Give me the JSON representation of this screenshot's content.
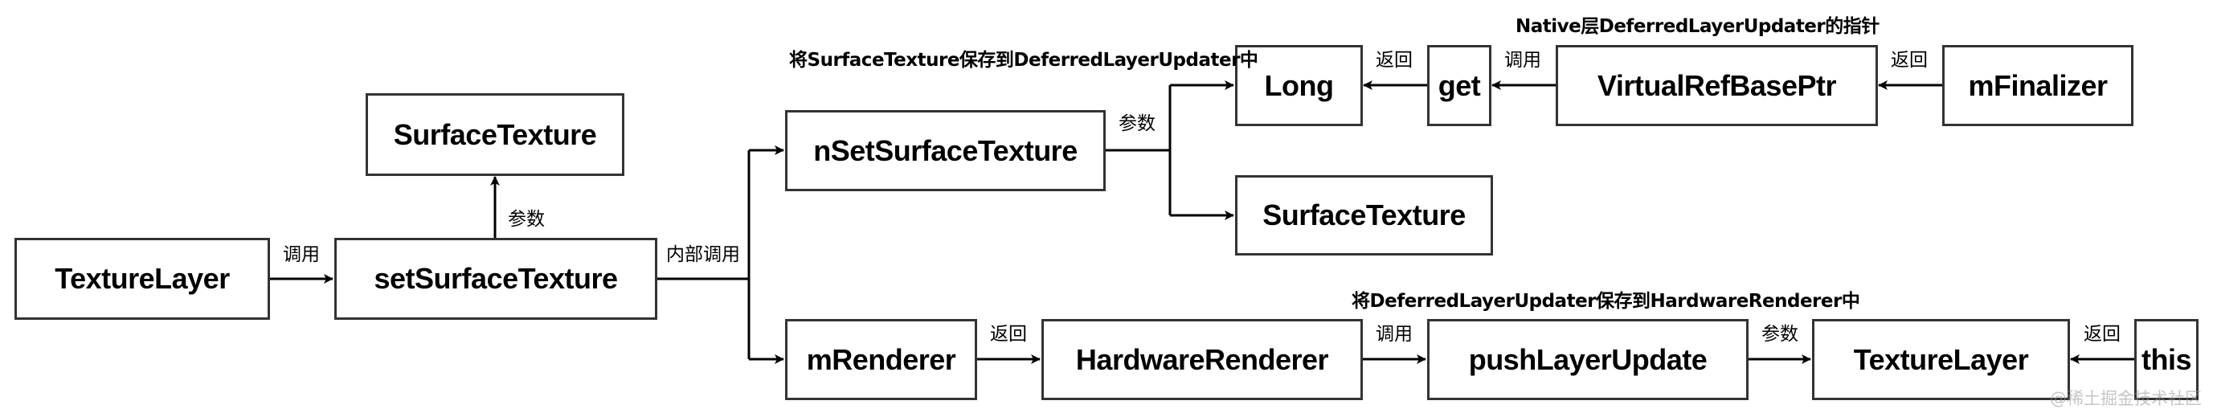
{
  "diagram": {
    "style": {
      "border_color": "#333333",
      "line_color": "#000000",
      "text_color": "#000000",
      "background": "#ffffff"
    },
    "nodes": {
      "texture_layer_src": "TextureLayer",
      "set_surface_texture": "setSurfaceTexture",
      "surface_texture_param": "SurfaceTexture",
      "n_set_surface_texture": "nSetSurfaceTexture",
      "long": "Long",
      "get": "get",
      "virtual_ref_base_ptr": "VirtualRefBasePtr",
      "m_finalizer": "mFinalizer",
      "surface_texture_native": "SurfaceTexture",
      "m_renderer": "mRenderer",
      "hardware_renderer": "HardwareRenderer",
      "push_layer_update": "pushLayerUpdate",
      "texture_layer_dst": "TextureLayer",
      "this": "this"
    },
    "edge_labels": {
      "texture_layer_to_set": "调用",
      "set_to_surface_texture": "参数",
      "set_internal_call": "内部调用",
      "n_set_params": "参数",
      "get_to_long": "返回",
      "vrbp_to_get": "调用",
      "finalizer_to_vrbp": "返回",
      "renderer_to_hw": "返回",
      "hw_to_push": "调用",
      "push_to_texture_layer": "参数",
      "this_to_texture_layer": "返回"
    },
    "notes": {
      "save_surface_texture": "将SurfaceTexture保存到DeferredLayerUpdater中",
      "native_pointer": "Native层DeferredLayerUpdater的指针",
      "save_updater": "将DeferredLayerUpdater保存到HardwareRenderer中"
    },
    "edges": [
      {
        "from": "TextureLayer",
        "to": "setSurfaceTexture",
        "label": "调用"
      },
      {
        "from": "setSurfaceTexture",
        "to": "SurfaceTexture",
        "label": "参数"
      },
      {
        "from": "setSurfaceTexture",
        "to": "nSetSurfaceTexture",
        "label": "内部调用"
      },
      {
        "from": "setSurfaceTexture",
        "to": "mRenderer",
        "label": "内部调用"
      },
      {
        "from": "nSetSurfaceTexture",
        "to": "Long",
        "label": "参数"
      },
      {
        "from": "nSetSurfaceTexture",
        "to": "SurfaceTexture",
        "label": "参数"
      },
      {
        "from": "get",
        "to": "Long",
        "label": "返回"
      },
      {
        "from": "VirtualRefBasePtr",
        "to": "get",
        "label": "调用"
      },
      {
        "from": "mFinalizer",
        "to": "VirtualRefBasePtr",
        "label": "返回"
      },
      {
        "from": "mRenderer",
        "to": "HardwareRenderer",
        "label": "返回"
      },
      {
        "from": "HardwareRenderer",
        "to": "pushLayerUpdate",
        "label": "调用"
      },
      {
        "from": "pushLayerUpdate",
        "to": "TextureLayer",
        "label": "参数"
      },
      {
        "from": "this",
        "to": "TextureLayer",
        "label": "返回"
      }
    ]
  },
  "watermark": "@稀土掘金技术社区"
}
